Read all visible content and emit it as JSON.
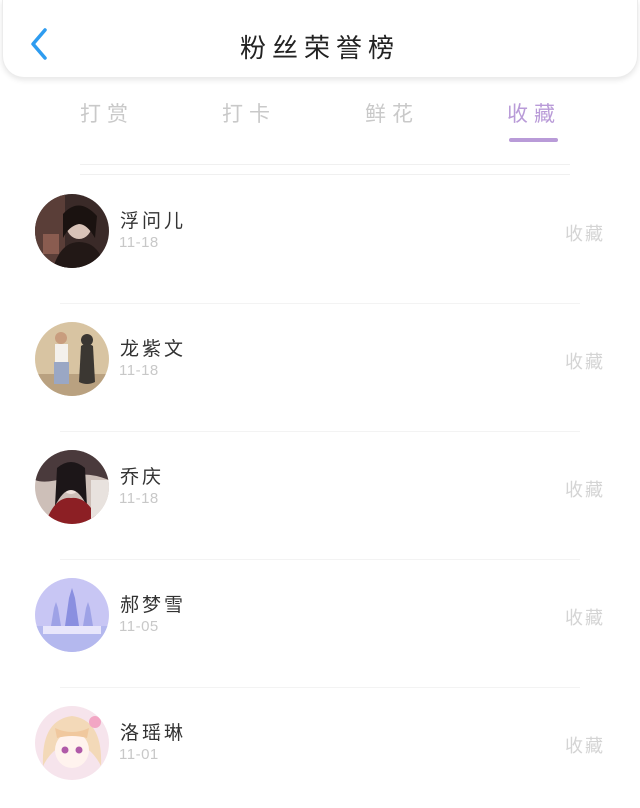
{
  "header": {
    "title": "粉丝荣誉榜",
    "back_icon": "chevron-left-icon",
    "back_color": "#2e9cf0"
  },
  "tabs": [
    {
      "label": "打赏",
      "active": false
    },
    {
      "label": "打卡",
      "active": false
    },
    {
      "label": "鲜花",
      "active": false
    },
    {
      "label": "收藏",
      "active": true
    }
  ],
  "accent_color": "#b99bd8",
  "list": [
    {
      "name": "浮问儿",
      "date": "11-18",
      "action": "收藏"
    },
    {
      "name": "龙紫文",
      "date": "11-18",
      "action": "收藏"
    },
    {
      "name": "乔庆",
      "date": "11-18",
      "action": "收藏"
    },
    {
      "name": "郝梦雪",
      "date": "11-05",
      "action": "收藏"
    },
    {
      "name": "洛瑶琳",
      "date": "11-01",
      "action": "收藏"
    }
  ]
}
